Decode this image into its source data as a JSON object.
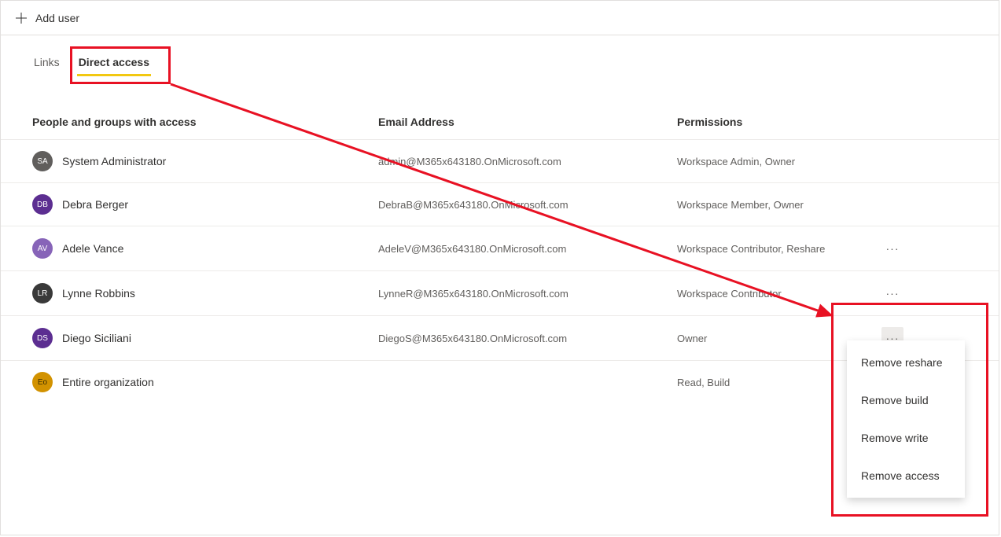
{
  "toolbar": {
    "add_user_label": "Add user"
  },
  "tabs": {
    "links_label": "Links",
    "direct_access_label": "Direct access"
  },
  "columns": {
    "people": "People and groups with access",
    "email": "Email Address",
    "permissions": "Permissions"
  },
  "users": [
    {
      "initials": "SA",
      "avatar_color": "#605e5c",
      "avatar_text": "#ffffff",
      "name": "System Administrator",
      "email": "admin@M365x643180.OnMicrosoft.com",
      "permissions": "Workspace Admin, Owner",
      "has_actions": false,
      "highlighted": false
    },
    {
      "initials": "DB",
      "avatar_color": "#5c2e91",
      "avatar_text": "#ffffff",
      "name": "Debra Berger",
      "email": "DebraB@M365x643180.OnMicrosoft.com",
      "permissions": "Workspace Member, Owner",
      "has_actions": false,
      "highlighted": false
    },
    {
      "initials": "AV",
      "avatar_color": "#8764b8",
      "avatar_text": "#ffffff",
      "name": "Adele Vance",
      "email": "AdeleV@M365x643180.OnMicrosoft.com",
      "permissions": "Workspace Contributor, Reshare",
      "has_actions": true,
      "highlighted": false
    },
    {
      "initials": "LR",
      "avatar_color": "#393939",
      "avatar_text": "#ffffff",
      "name": "Lynne Robbins",
      "email": "LynneR@M365x643180.OnMicrosoft.com",
      "permissions": "Workspace Contributor",
      "has_actions": true,
      "highlighted": false
    },
    {
      "initials": "DS",
      "avatar_color": "#5c2e91",
      "avatar_text": "#ffffff",
      "name": "Diego Siciliani",
      "email": "DiegoS@M365x643180.OnMicrosoft.com",
      "permissions": "Owner",
      "has_actions": true,
      "highlighted": true
    },
    {
      "initials": "Eo",
      "avatar_color": "#d29200",
      "avatar_text": "#3b2e00",
      "name": "Entire organization",
      "email": "",
      "permissions": "Read, Build",
      "has_actions": false,
      "highlighted": false
    }
  ],
  "context_menu": {
    "items": [
      "Remove reshare",
      "Remove build",
      "Remove write",
      "Remove access"
    ]
  }
}
